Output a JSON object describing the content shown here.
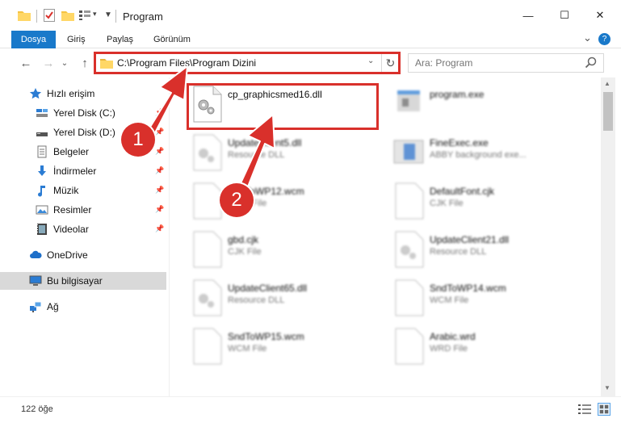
{
  "window": {
    "title": "Program",
    "minimize": "—",
    "maximize": "☐",
    "close": "✕"
  },
  "ribbon": {
    "tabs": [
      "Dosya",
      "Giriş",
      "Paylaş",
      "Görünüm"
    ],
    "collapse": "⌄",
    "help": "?"
  },
  "address": {
    "path": "C:\\Program Files\\Program Dizini",
    "dropdown": "⌄",
    "refresh": "↻"
  },
  "search": {
    "placeholder": "Ara: Program"
  },
  "nav": {
    "back": "←",
    "forward": "→",
    "recent": "⌄",
    "up": "↑"
  },
  "sidebar": {
    "quick_access": "Hızlı erişim",
    "items": [
      {
        "label": "Yerel Disk (C:)",
        "icon": "drive-icon"
      },
      {
        "label": "Yerel Disk (D:)",
        "icon": "drive-icon"
      },
      {
        "label": "Belgeler",
        "icon": "documents-icon"
      },
      {
        "label": "İndirmeler",
        "icon": "download-icon"
      },
      {
        "label": "Müzik",
        "icon": "music-icon"
      },
      {
        "label": "Resimler",
        "icon": "pictures-icon"
      },
      {
        "label": "Videolar",
        "icon": "video-icon"
      }
    ],
    "onedrive": "OneDrive",
    "this_pc": "Bu bilgisayar",
    "network": "Ağ",
    "pin": "📌"
  },
  "files": [
    {
      "name": "cp_graphicsmed16.dll",
      "type": ""
    },
    {
      "name": "program.exe",
      "type": ""
    },
    {
      "name": "UpdateClient5.dll",
      "type": "Resource DLL"
    },
    {
      "name": "FineExec.exe",
      "type": "ABBY background exe..."
    },
    {
      "name": "SndToWP12.wcm",
      "type": "WCM File"
    },
    {
      "name": "DefaultFont.cjk",
      "type": "CJK File"
    },
    {
      "name": "gbd.cjk",
      "type": "CJK File"
    },
    {
      "name": "UpdateClient21.dll",
      "type": "Resource DLL"
    },
    {
      "name": "UpdateClient65.dll",
      "type": "Resource DLL"
    },
    {
      "name": "SndToWP14.wcm",
      "type": "WCM File"
    },
    {
      "name": "SndToWP15.wcm",
      "type": "WCM File"
    },
    {
      "name": "Arabic.wrd",
      "type": "WRD File"
    }
  ],
  "status": {
    "count": "122 öğe"
  },
  "steps": {
    "one": "1",
    "two": "2"
  },
  "colors": {
    "accent": "#1979ca",
    "highlight": "#d9302b",
    "selected": "#d9d9d9"
  }
}
